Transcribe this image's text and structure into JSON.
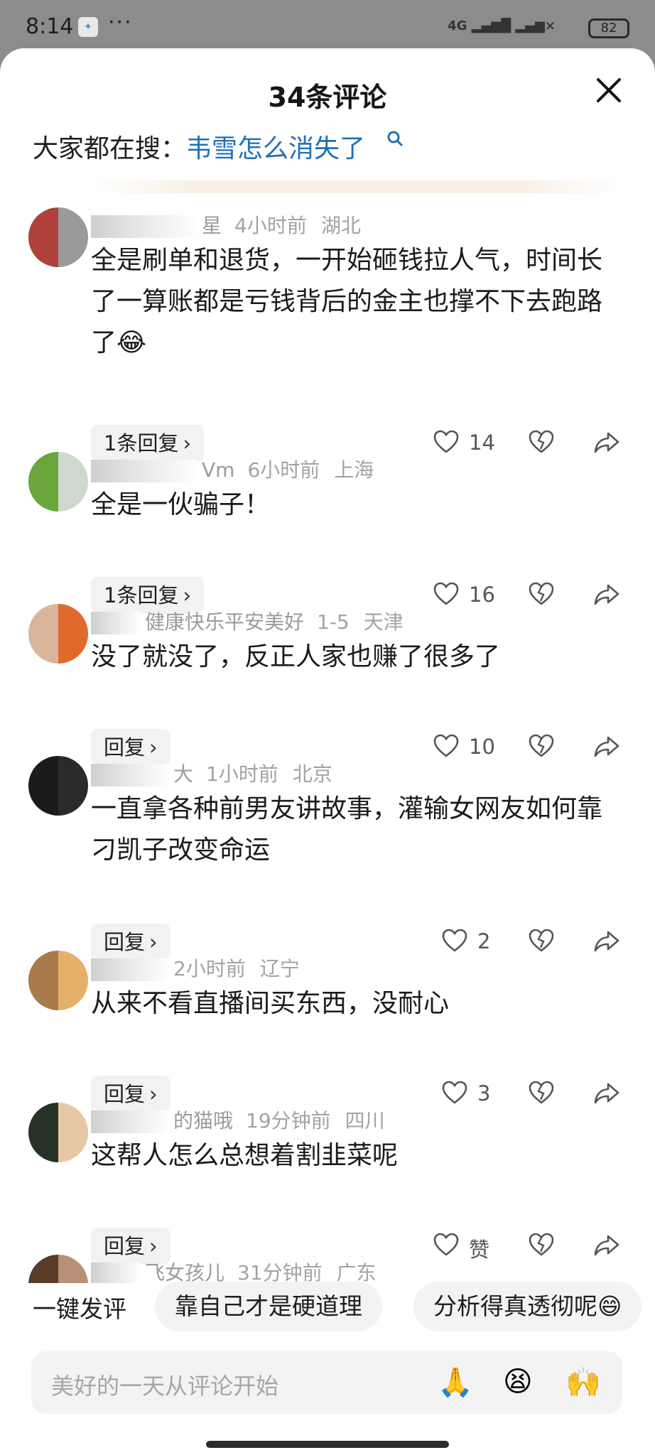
{
  "status": {
    "time": "8:14",
    "dots": "···",
    "signal": "4G ▂▄▆█ ▂▄▆×",
    "battery": "82"
  },
  "sheet": {
    "title": "34条评论",
    "hot_search_label": "大家都在搜：",
    "hot_search_term": "韦雪怎么消失了"
  },
  "comments": [
    {
      "name_tail": "星",
      "time": "4小时前",
      "location": "湖北",
      "text": "全是刷单和退货，一开始砸钱拉人气，时间长了一算账都是亏钱背后的金主也撑不下去跑路了😂",
      "reply": "1条回复",
      "likes": "14"
    },
    {
      "name_tail": "Vm",
      "time": "6小时前",
      "location": "上海",
      "text": "全是一伙骗子！",
      "reply": "1条回复",
      "likes": "16"
    },
    {
      "name_tail": "健康快乐平安美好",
      "time": "1-5",
      "location": "天津",
      "text": "没了就没了，反正人家也赚了很多了",
      "reply": "回复",
      "likes": "10"
    },
    {
      "name_tail": "大",
      "time": "1小时前",
      "location": "北京",
      "text": "一直拿各种前男友讲故事，灌输女网友如何靠刁凯子改变命运",
      "reply": "回复",
      "likes": "2"
    },
    {
      "name_tail": "",
      "time": "2小时前",
      "location": "辽宁",
      "text": "从来不看直播间买东西，没耐心",
      "reply": "回复",
      "likes": "3"
    },
    {
      "name_tail": "的猫哦",
      "time": "19分钟前",
      "location": "四川",
      "text": "这帮人怎么总想着割韭菜呢",
      "reply": "回复",
      "likes": "赞"
    },
    {
      "name_tail": "飞女孩儿",
      "time": "31分钟前",
      "location": "广东"
    }
  ],
  "quick": {
    "label": "一键发评",
    "chip1": "靠自己才是硬道理",
    "chip2": "分析得真透彻呢😄"
  },
  "input": {
    "placeholder": "美好的一天从评论开始",
    "emoji1": "🙏",
    "emoji2": "😫",
    "emoji3": "🙌"
  },
  "colors": {
    "accent_link": "#1f6fb8",
    "meta_gray": "#a3a3a3"
  }
}
